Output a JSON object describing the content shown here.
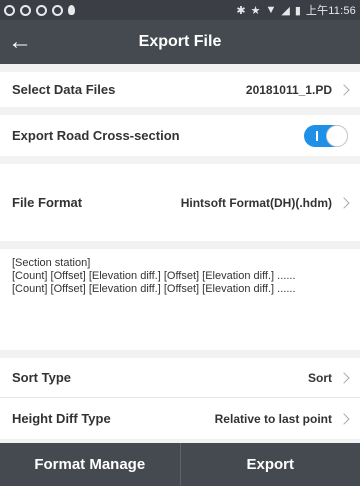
{
  "status_bar": {
    "time": "上午11:56"
  },
  "header": {
    "title": "Export File",
    "back_icon": "arrow-left-icon"
  },
  "rows": {
    "select_data_files": {
      "label": "Select Data Files",
      "value": "20181011_1.PD"
    },
    "export_road": {
      "label": "Export Road Cross-section",
      "toggle_on": true
    },
    "file_format": {
      "label": "File Format",
      "value": "Hintsoft Format(DH)(.hdm)"
    },
    "sort_type": {
      "label": "Sort Type",
      "value": "Sort"
    },
    "height_diff": {
      "label": "Height Diff Type",
      "value": "Relative to last point"
    }
  },
  "description": {
    "line1": "[Section station]",
    "line2": "[Count] [Offset] [Elevation diff.] [Offset] [Elevation diff.] ......",
    "line3": "[Count] [Offset] [Elevation diff.] [Offset] [Elevation diff.] ......"
  },
  "footer": {
    "format_manage": "Format Manage",
    "export": "Export"
  },
  "colors": {
    "app_bar": "#454a50",
    "status_bar": "#3b3f45",
    "toggle_accent": "#1e90e8"
  }
}
